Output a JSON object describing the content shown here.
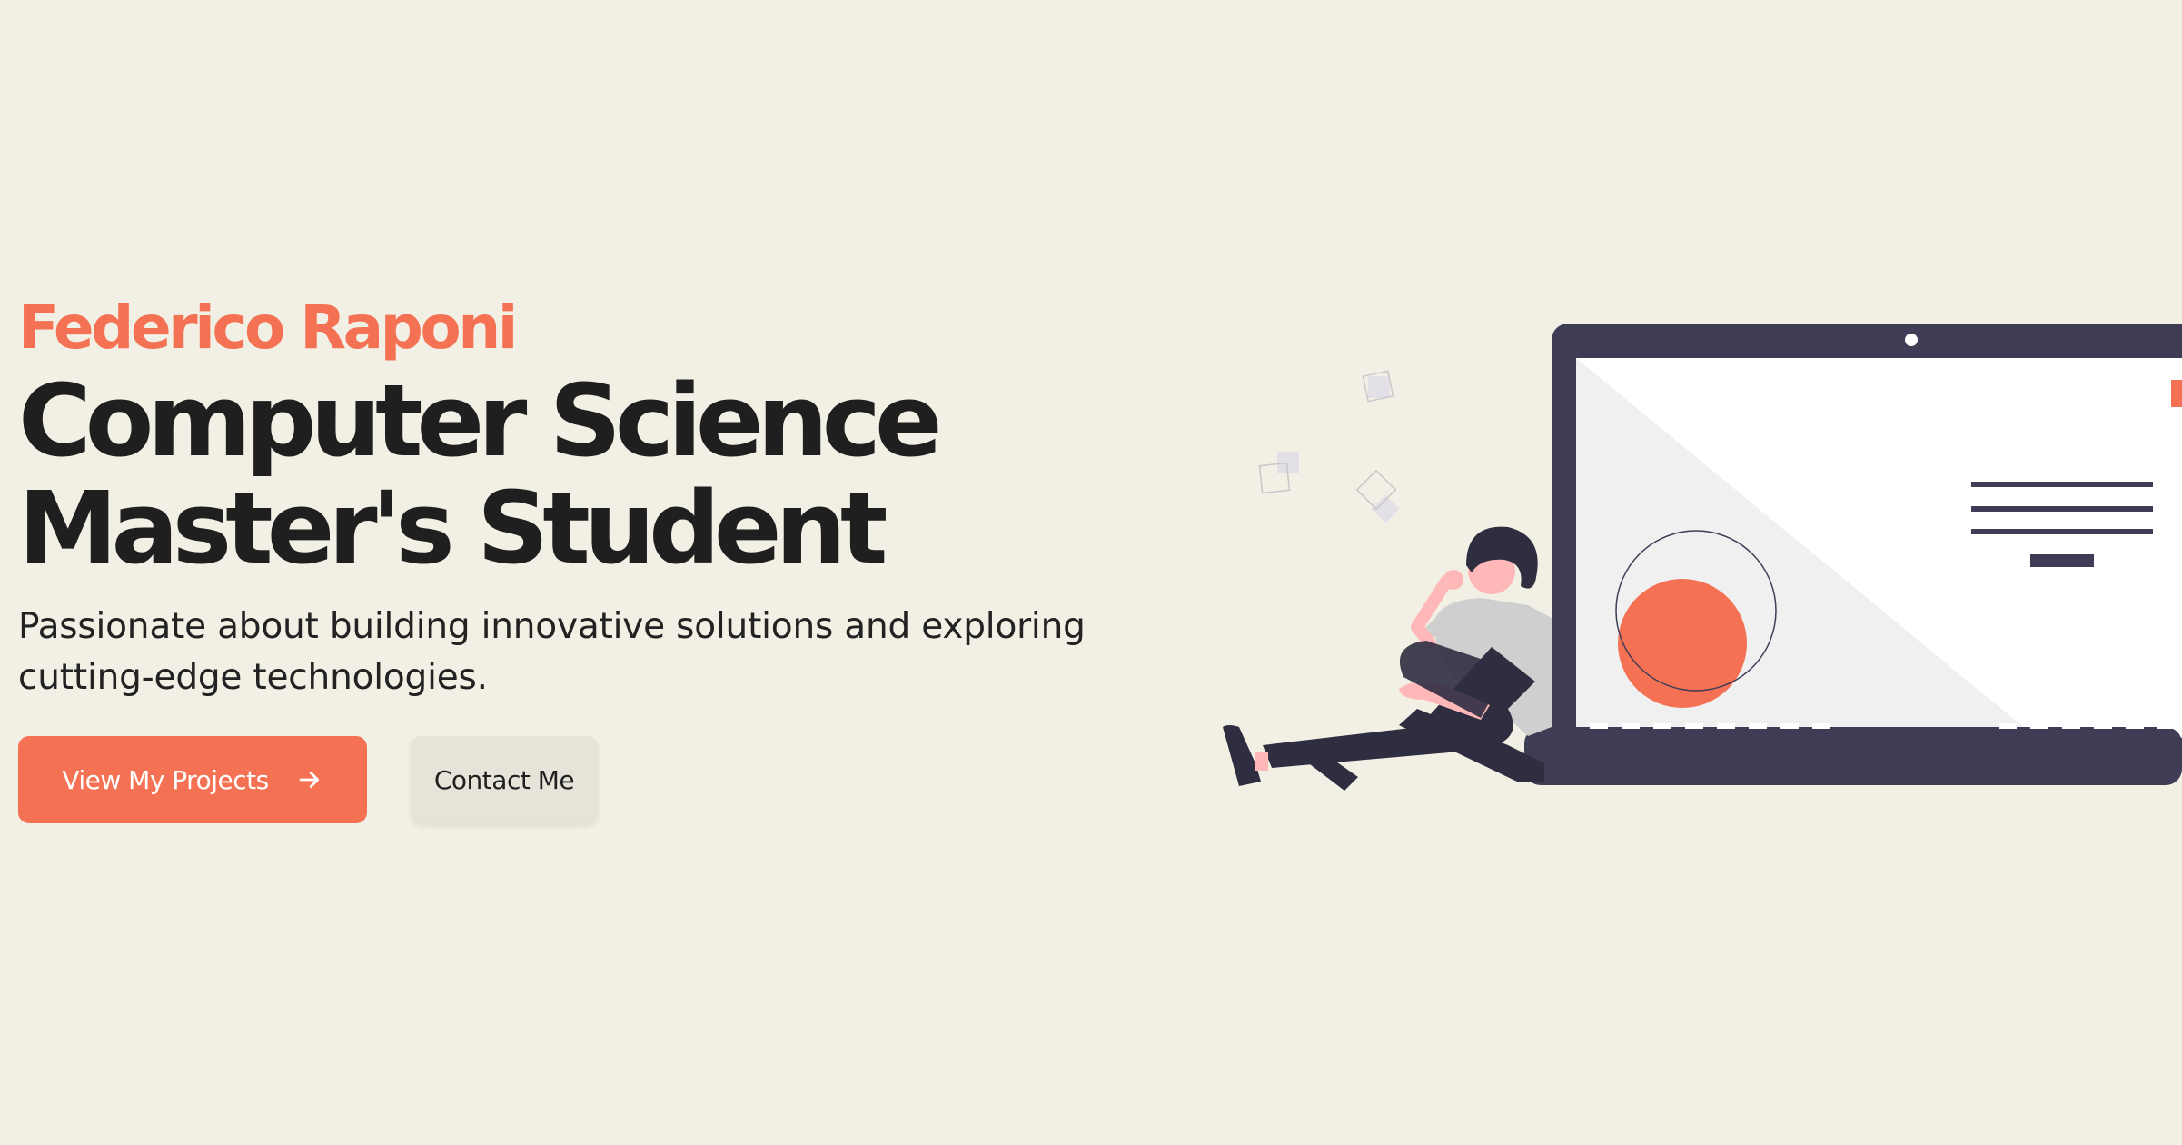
{
  "hero": {
    "name": "Federico Raponi",
    "title_line1": "Computer Science",
    "title_line2": "Master's Student",
    "description_line1": "Passionate about building innovative solutions and exploring",
    "description_line2": "cutting-edge technologies."
  },
  "buttons": {
    "primary_label": "View My Projects",
    "primary_icon": "arrow-right-icon",
    "secondary_label": "Contact Me"
  },
  "colors": {
    "background": "#f2efe4",
    "accent": "#f47253",
    "text": "#1f1f1f",
    "laptop": "#3f3d56",
    "secondary_button": "#e6e3d9"
  }
}
